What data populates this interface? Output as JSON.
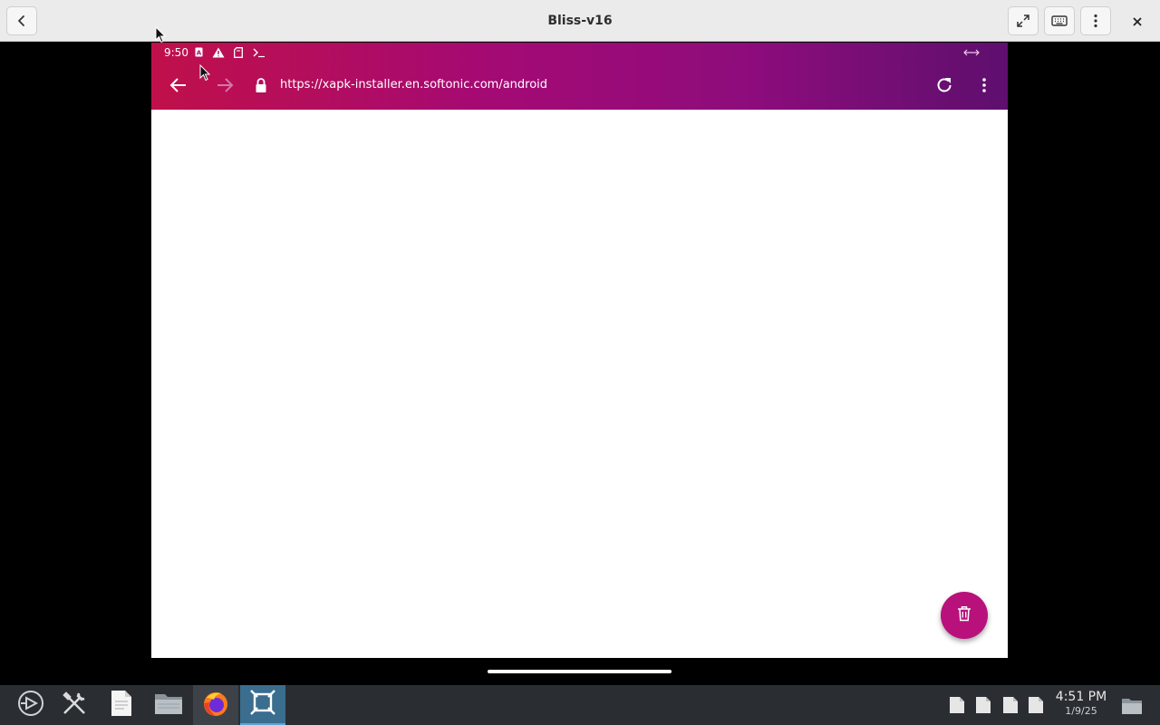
{
  "window": {
    "title": "Bliss-v16"
  },
  "android": {
    "status": {
      "time": "9:50"
    },
    "browser": {
      "url": "https://xapk-installer.en.softonic.com/android"
    }
  },
  "taskbar": {
    "clock_time": "4:51 PM",
    "clock_date": "1/9/25"
  },
  "colors": {
    "appbar_start": "#c0104a",
    "appbar_end": "#5e0f6e",
    "fab": "#b8117c"
  }
}
